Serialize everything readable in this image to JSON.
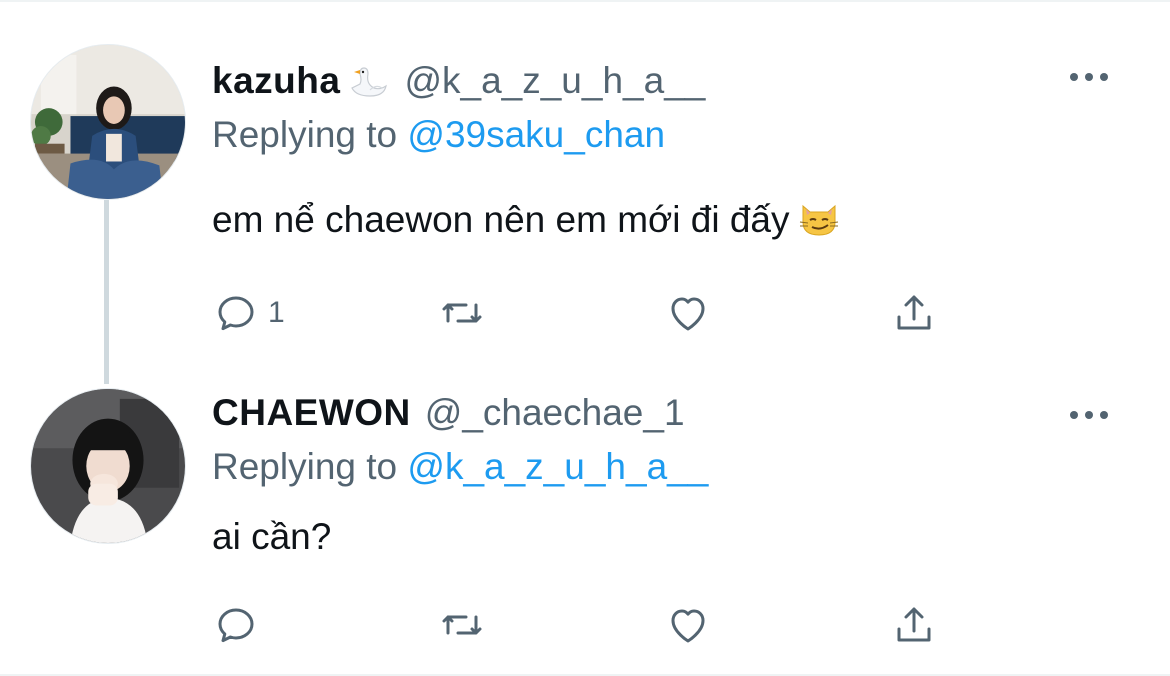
{
  "colors": {
    "text_primary": "#0f1419",
    "text_secondary": "#536471",
    "link": "#1d9bf0",
    "thread_line": "#cfd9de",
    "background": "#ffffff"
  },
  "tweets": [
    {
      "display_name": "kazuha",
      "name_emoji": "swan-emoji",
      "handle": "@k_a_z_u_h_a__",
      "replying_prefix": "Replying to",
      "replying_handle": "@39saku_chan",
      "text": "em nể chaewon nên em mới đi đấy",
      "text_emoji": "smirking-cat-emoji",
      "reply_count": "1",
      "icons": [
        "reply-icon",
        "retweet-icon",
        "like-icon",
        "share-icon",
        "more-icon"
      ]
    },
    {
      "display_name": "CHAEWON",
      "handle": "@_chaechae_1",
      "replying_prefix": "Replying to",
      "replying_handle": "@k_a_z_u_h_a__",
      "text": "ai cần?",
      "reply_count": "",
      "icons": [
        "reply-icon",
        "retweet-icon",
        "like-icon",
        "share-icon",
        "more-icon"
      ]
    }
  ]
}
